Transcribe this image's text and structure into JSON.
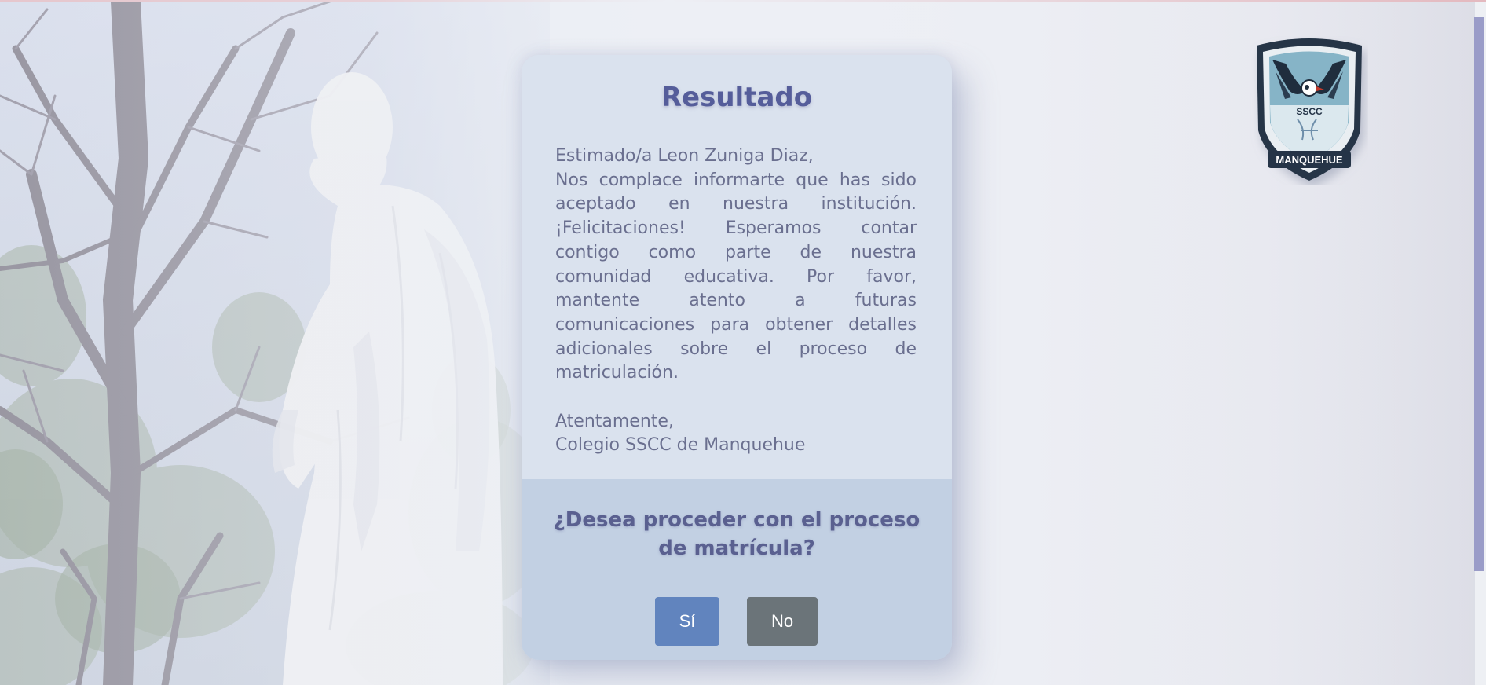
{
  "modal": {
    "title": "Resultado",
    "greeting": "Estimado/a Leon Zuniga Diaz,",
    "message": "Nos complace informarte que has sido aceptado en nuestra institución. ¡Felicitaciones! Esperamos contar contigo como parte de nuestra comunidad educativa. Por favor, mantente atento a futuras comunicaciones para obtener detalles adicionales sobre el proceso de matriculación.",
    "closing": "Atentamente,",
    "signature": "Colegio SSCC de Manquehue",
    "question": "¿Desea proceder con el proceso de matrícula?",
    "yes_label": "Sí",
    "no_label": "No"
  },
  "logo": {
    "top_text": "SSCC",
    "bottom_text": "MANQUEHUE"
  },
  "colors": {
    "title": "#555d9a",
    "yes_button": "#6184be",
    "no_button": "#6b7479",
    "scrollbar_thumb": "#9a9cc8"
  }
}
